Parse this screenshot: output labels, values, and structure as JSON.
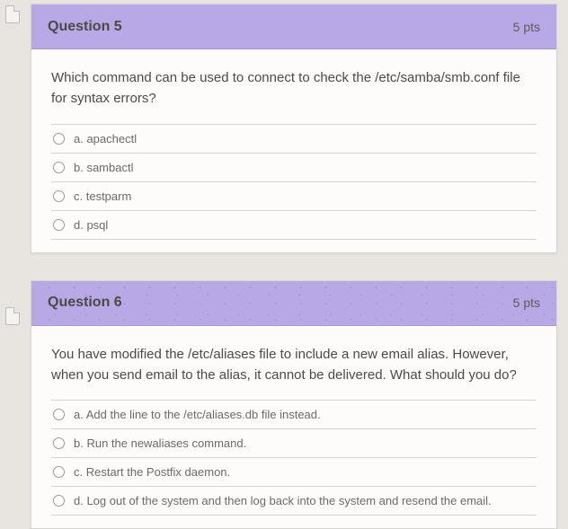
{
  "questions": [
    {
      "title": "Question 5",
      "points": "5 pts",
      "prompt": "Which command can be used to connect to check the /etc/samba/smb.conf file for syntax errors?",
      "options": [
        "a. apachectl",
        "b. sambactl",
        "c. testparm",
        "d. psql"
      ]
    },
    {
      "title": "Question 6",
      "points": "5 pts",
      "prompt": "You have modified the /etc/aliases file to include a new email alias. However, when you send email to the alias, it cannot be delivered. What should you do?",
      "options": [
        "a. Add the line to the /etc/aliases.db file instead.",
        "b. Run the newaliases command.",
        "c. Restart the Postfix daemon.",
        "d. Log out of the system and then log back into the system and resend the email."
      ]
    }
  ]
}
